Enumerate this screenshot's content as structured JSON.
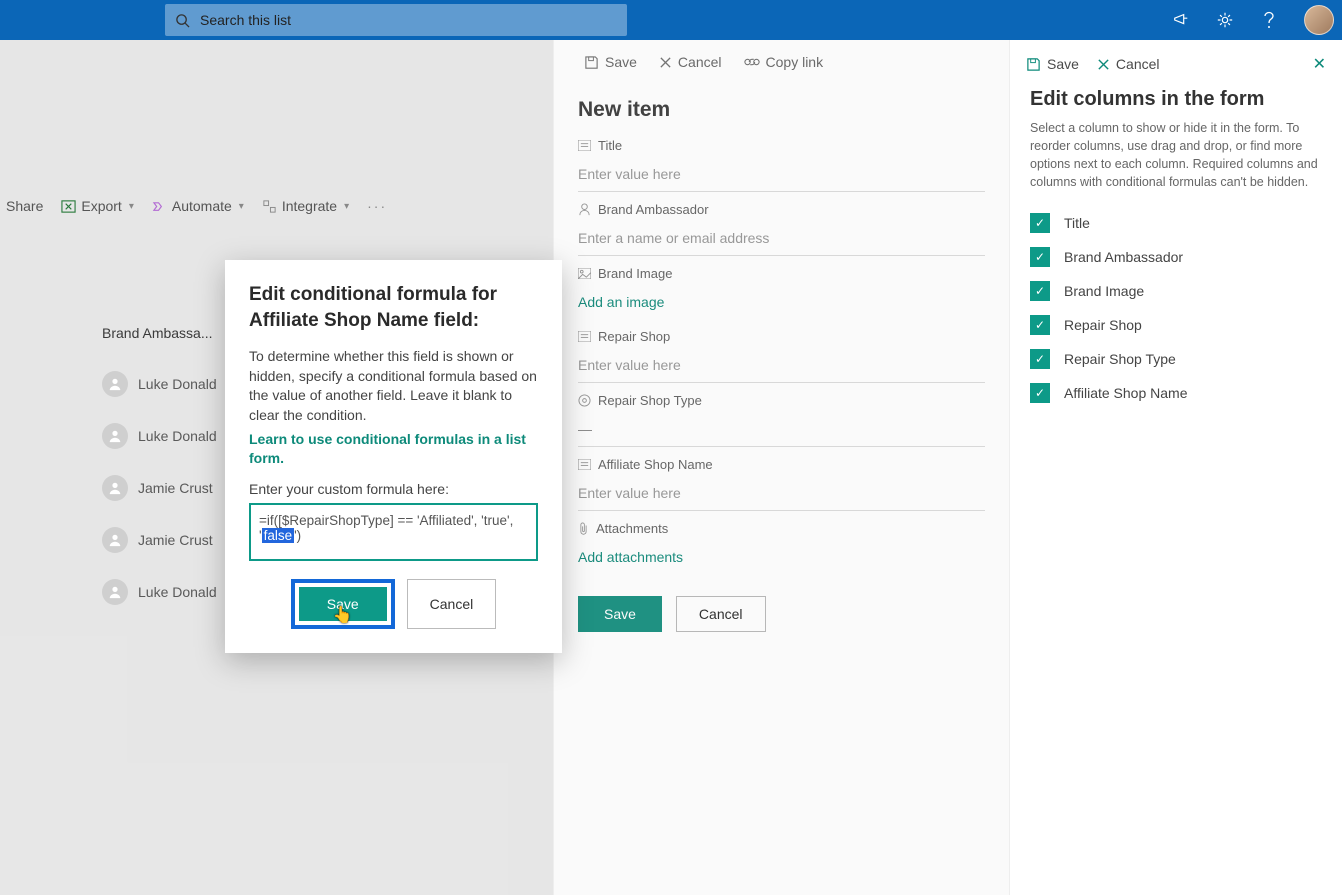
{
  "suite": {
    "search_placeholder": "Search this list"
  },
  "cmdbar": {
    "share": "Share",
    "export": "Export",
    "automate": "Automate",
    "integrate": "Integrate"
  },
  "list": {
    "col_header": "Brand Ambassa...",
    "rows": [
      "Luke Donald",
      "Luke Donald",
      "Jamie Crust",
      "Jamie Crust",
      "Luke Donald"
    ]
  },
  "new_item": {
    "cmd_save": "Save",
    "cmd_cancel": "Cancel",
    "cmd_copy": "Copy link",
    "title": "New item",
    "fields": {
      "title": {
        "label": "Title",
        "placeholder": "Enter value here"
      },
      "brand_ambassador": {
        "label": "Brand Ambassador",
        "placeholder": "Enter a name or email address"
      },
      "brand_image": {
        "label": "Brand Image",
        "link": "Add an image"
      },
      "repair_shop": {
        "label": "Repair Shop",
        "placeholder": "Enter value here"
      },
      "repair_shop_type": {
        "label": "Repair Shop Type",
        "value": "—"
      },
      "affiliate_shop_name": {
        "label": "Affiliate Shop Name",
        "placeholder": "Enter value here"
      },
      "attachments": {
        "label": "Attachments",
        "link": "Add attachments"
      }
    },
    "save_btn": "Save",
    "cancel_btn": "Cancel"
  },
  "edit_cols": {
    "save": "Save",
    "cancel": "Cancel",
    "title": "Edit columns in the form",
    "desc": "Select a column to show or hide it in the form. To reorder columns, use drag and drop, or find more options next to each column. Required columns and columns with conditional formulas can't be hidden.",
    "items": [
      "Title",
      "Brand Ambassador",
      "Brand Image",
      "Repair Shop",
      "Repair Shop Type",
      "Affiliate Shop Name"
    ]
  },
  "modal": {
    "title": "Edit conditional formula for Affiliate Shop Name field:",
    "body": "To determine whether this field is shown or hidden, specify a conditional formula based on the value of another field. Leave it blank to clear the condition.",
    "learn": "Learn to use conditional formulas in a list form.",
    "input_label": "Enter your custom formula here:",
    "formula_pre": "=if([$RepairShopType] == 'Affiliated', 'true', '",
    "formula_sel": "false",
    "formula_post": "')",
    "save": "Save",
    "cancel": "Cancel"
  }
}
